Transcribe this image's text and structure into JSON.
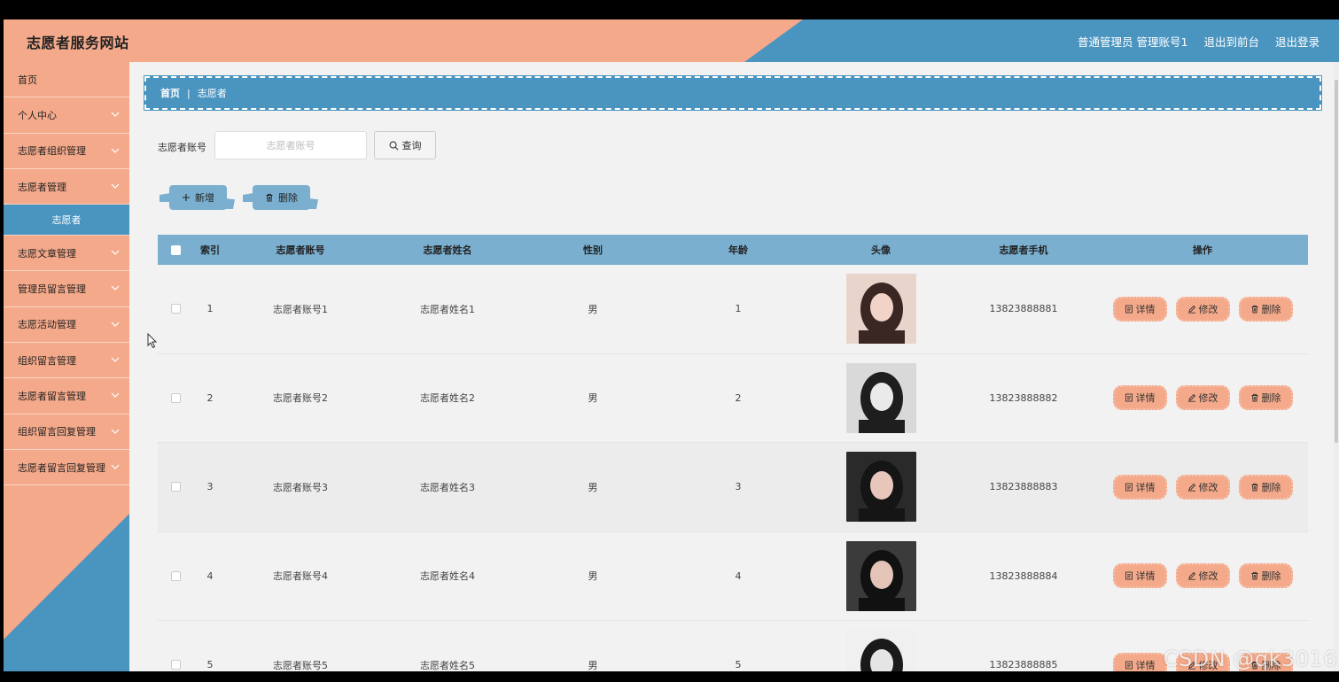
{
  "header": {
    "title": "志愿者服务网站",
    "user": "普通管理员 管理账号1",
    "front_link": "退出到前台",
    "logout": "退出登录"
  },
  "sidebar": {
    "items": [
      {
        "label": "首页"
      },
      {
        "label": "个人中心"
      },
      {
        "label": "志愿者组织管理"
      },
      {
        "label": "志愿者管理"
      },
      {
        "label": "志愿文章管理"
      },
      {
        "label": "管理员留言管理"
      },
      {
        "label": "志愿活动管理"
      },
      {
        "label": "组织留言管理"
      },
      {
        "label": "志愿者留言管理"
      },
      {
        "label": "组织留言回复管理"
      },
      {
        "label": "志愿者留言回复管理"
      }
    ],
    "active_sub": "志愿者"
  },
  "breadcrumb": {
    "home": "首页",
    "current": "志愿者"
  },
  "search": {
    "label": "志愿者账号",
    "placeholder": "志愿者账号",
    "button": "查询"
  },
  "actions": {
    "add": "新增",
    "delete": "删除"
  },
  "table": {
    "headers": [
      "索引",
      "志愿者账号",
      "志愿者姓名",
      "性别",
      "年龄",
      "头像",
      "志愿者手机",
      "操作"
    ],
    "rows": [
      {
        "index": "1",
        "account": "志愿者账号1",
        "name": "志愿者姓名1",
        "sex": "男",
        "age": "1",
        "phone": "13823888881"
      },
      {
        "index": "2",
        "account": "志愿者账号2",
        "name": "志愿者姓名2",
        "sex": "男",
        "age": "2",
        "phone": "13823888882"
      },
      {
        "index": "3",
        "account": "志愿者账号3",
        "name": "志愿者姓名3",
        "sex": "男",
        "age": "3",
        "phone": "13823888883"
      },
      {
        "index": "4",
        "account": "志愿者账号4",
        "name": "志愿者姓名4",
        "sex": "男",
        "age": "4",
        "phone": "13823888884"
      },
      {
        "index": "5",
        "account": "志愿者账号5",
        "name": "志愿者姓名5",
        "sex": "男",
        "age": "5",
        "phone": "13823888885"
      }
    ],
    "op_labels": {
      "detail": "详情",
      "edit": "修改",
      "delete": "删除"
    }
  },
  "watermark": "CSDN @qk3016",
  "colors": {
    "peach": "#f4a98a",
    "blue": "#4a94c0",
    "light_blue": "#7aafcf"
  }
}
